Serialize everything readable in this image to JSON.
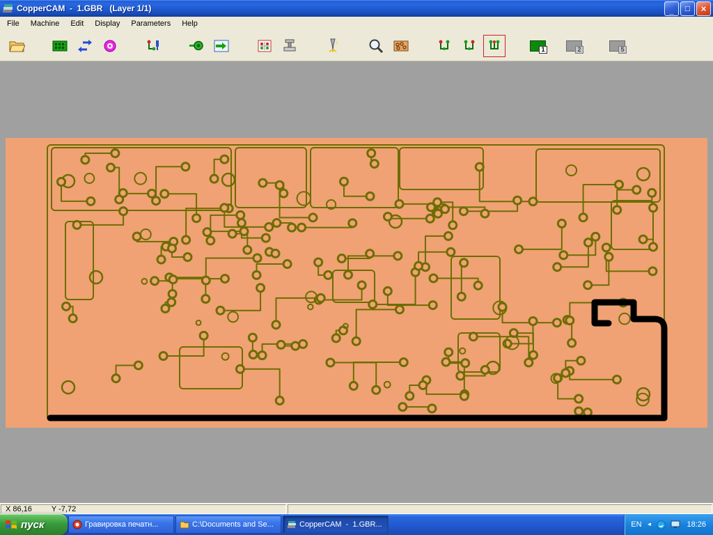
{
  "window": {
    "title": "CopperCAM  -  1.GBR   (Layer 1/1)",
    "controls": {
      "minimize": "_",
      "maximize": "□",
      "close": "×"
    }
  },
  "menu": {
    "items": [
      "File",
      "Machine",
      "Edit",
      "Display",
      "Parameters",
      "Help"
    ]
  },
  "toolbar": {
    "icon_names": [
      "open-file-icon",
      "board-icon",
      "transfer-arrows-icon",
      "tool-disc-icon",
      "plot-pins-icon",
      "tool-output-icon",
      "board-output-icon",
      "drill-board-icon",
      "press-icon",
      "engrave-cutter-icon",
      "zoom-icon",
      "copper-board-icon",
      "route-a-icon",
      "route-b-icon",
      "route-c-icon",
      "layer-chip-1-icon",
      "layer-chip-2-icon",
      "layer-chip-5-icon"
    ],
    "layer_labels": [
      "1",
      "2",
      "5"
    ]
  },
  "canvas": {
    "background": "#a0a0a0",
    "board_color": "#f0a274",
    "trace_color": "#6d6d00",
    "outline_color": "#000000"
  },
  "statusbar": {
    "x": "X 86,16",
    "y": "Y -7,72"
  },
  "taskbar": {
    "start_label": "пуск",
    "tasks": [
      {
        "label": "Гравировка печатн..."
      },
      {
        "label": "C:\\Documents and Se..."
      },
      {
        "label": "CopperCAM  -  1.GBR..."
      }
    ],
    "tray": {
      "language": "EN",
      "time": "18:26"
    }
  }
}
